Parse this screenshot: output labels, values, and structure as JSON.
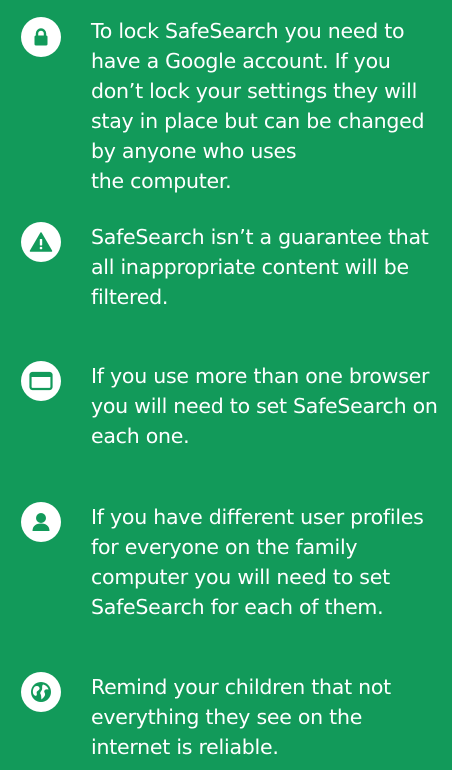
{
  "colors": {
    "background": "#129a5a",
    "text": "#ffffff",
    "icon_circle": "#ffffff",
    "icon_glyph": "#129a5a"
  },
  "tips": [
    {
      "icon": "lock-icon",
      "text": "To lock SafeSearch you need to\nhave a Google account. If you\ndon’t lock your settings they will\nstay in place but can be changed\nby anyone who uses\nthe computer."
    },
    {
      "icon": "warning-icon",
      "text": "SafeSearch isn’t a guarantee that\nall inappropriate content will be\nfiltered."
    },
    {
      "icon": "browser-window-icon",
      "text": "If you use more than one browser\nyou will need to set SafeSearch on\neach one."
    },
    {
      "icon": "user-profile-icon",
      "text": "If you have different user profiles\nfor everyone on the family\ncomputer you will need to set\nSafeSearch for each of them."
    },
    {
      "icon": "globe-icon",
      "text": "Remind your children that not\neverything they see on the\ninternet is reliable."
    }
  ]
}
